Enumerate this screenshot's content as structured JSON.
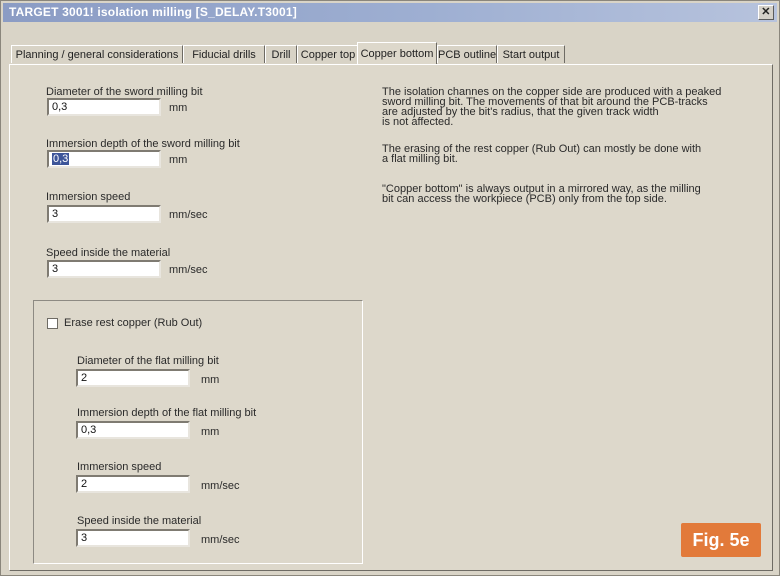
{
  "window": {
    "title": "TARGET 3001!  isolation milling  [S_DELAY.T3001]",
    "close_glyph": "✕"
  },
  "tabs": [
    {
      "label": "Planning / general considerations",
      "active": false
    },
    {
      "label": "Fiducial drills",
      "active": false
    },
    {
      "label": "Drill",
      "active": false
    },
    {
      "label": "Copper top",
      "active": false
    },
    {
      "label": "Copper bottom",
      "active": true
    },
    {
      "label": "PCB outline",
      "active": false
    },
    {
      "label": "Start output",
      "active": false
    }
  ],
  "sword": {
    "diameter": {
      "label": "Diameter of the sword milling bit",
      "value": "0,3",
      "unit": "mm"
    },
    "immersion_depth": {
      "label": "Immersion depth of the sword milling bit",
      "value": "0,3",
      "unit": "mm"
    },
    "immersion_speed": {
      "label": "Immersion speed",
      "value": "3",
      "unit": "mm/sec"
    },
    "speed_inside": {
      "label": "Speed inside the material",
      "value": "3",
      "unit": "mm/sec"
    }
  },
  "rub_out": {
    "checkbox_label": "Erase rest copper (Rub Out)",
    "checked": false,
    "diameter": {
      "label": "Diameter of the flat milling bit",
      "value": "2",
      "unit": "mm"
    },
    "immersion_depth": {
      "label": "Immersion depth of the flat milling bit",
      "value": "0,3",
      "unit": "mm"
    },
    "immersion_speed": {
      "label": "Immersion speed",
      "value": "2",
      "unit": "mm/sec"
    },
    "speed_inside": {
      "label": "Speed inside the material",
      "value": "3",
      "unit": "mm/sec"
    }
  },
  "description": {
    "para1": [
      "The isolation channes on the copper side are produced with a peaked",
      "sword milling bit. The movements of that bit around the PCB-tracks",
      "are adjusted by the bit's radius, that the given track width",
      "is not affected."
    ],
    "para2": [
      "The erasing of the rest copper (Rub Out) can mostly be done with",
      "a flat milling bit."
    ],
    "para3": [
      "\"Copper bottom\" is always output in a mirrored way, as the milling",
      "bit can access the workpiece (PCB) only from the top side."
    ]
  },
  "figure_label": "Fig. 5e"
}
